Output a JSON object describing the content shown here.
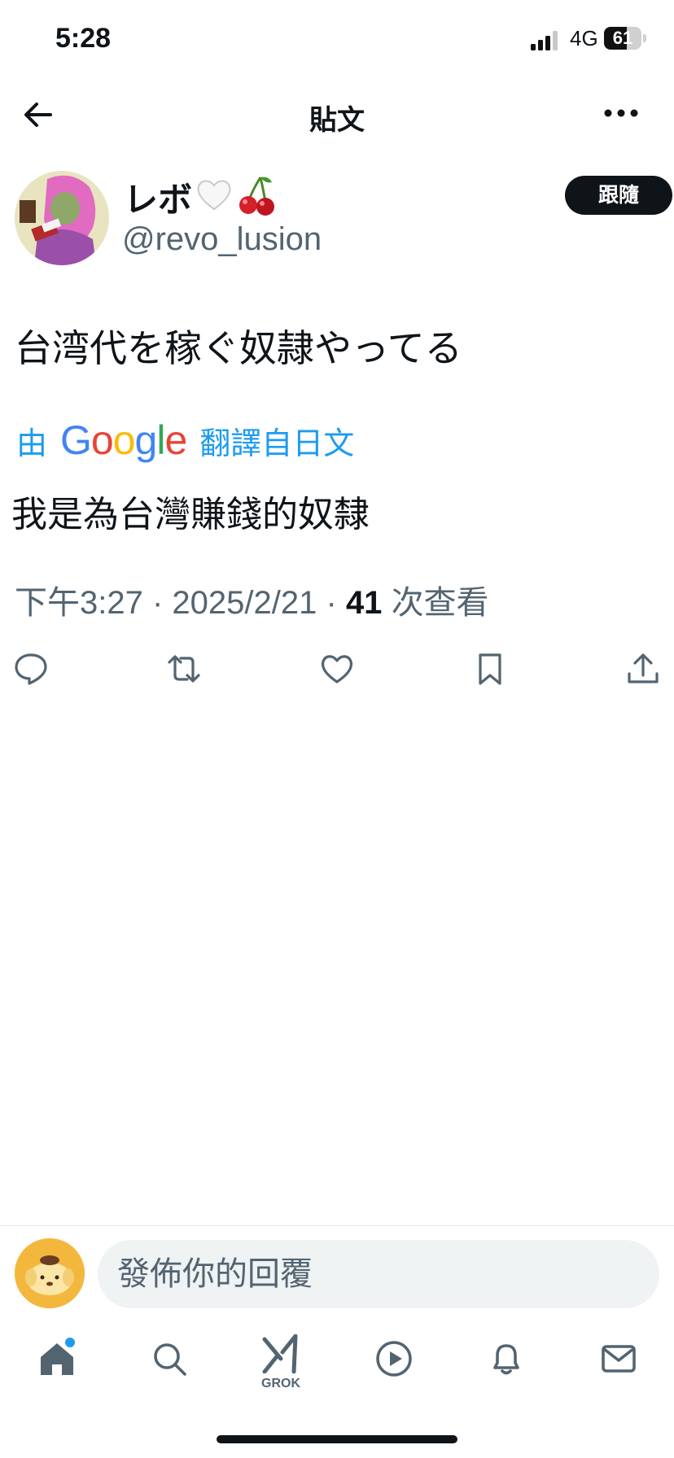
{
  "status_bar": {
    "time": "5:28",
    "network": "4G",
    "battery_level": "61",
    "battery_fraction": 0.61
  },
  "header": {
    "title": "貼文"
  },
  "author": {
    "display_name": "レボ",
    "handle": "@revo_lusion",
    "follow_label": "跟隨",
    "badges": [
      "white-heart-icon",
      "cherry-icon"
    ]
  },
  "post": {
    "text": "台湾代を稼ぐ奴隷やってる",
    "translation": {
      "prefix": "由",
      "provider": "Google",
      "suffix": "翻譯自日文",
      "text": "我是為台灣賺錢的奴隸"
    },
    "meta": {
      "time": "下午3:27",
      "date": "2025/2/21",
      "views": "41",
      "views_label": "次查看"
    }
  },
  "actions": [
    "reply-icon",
    "repost-icon",
    "like-icon",
    "bookmark-icon",
    "share-icon"
  ],
  "reply": {
    "placeholder": "發佈你的回覆"
  },
  "tabbar": {
    "grok_label": "GROK",
    "items": [
      "home-icon",
      "search-icon",
      "grok-icon",
      "video-icon",
      "notifications-icon",
      "messages-icon"
    ]
  },
  "colors": {
    "accent": "#1d9bf0",
    "text": "#0f1419",
    "secondary": "#536471"
  }
}
